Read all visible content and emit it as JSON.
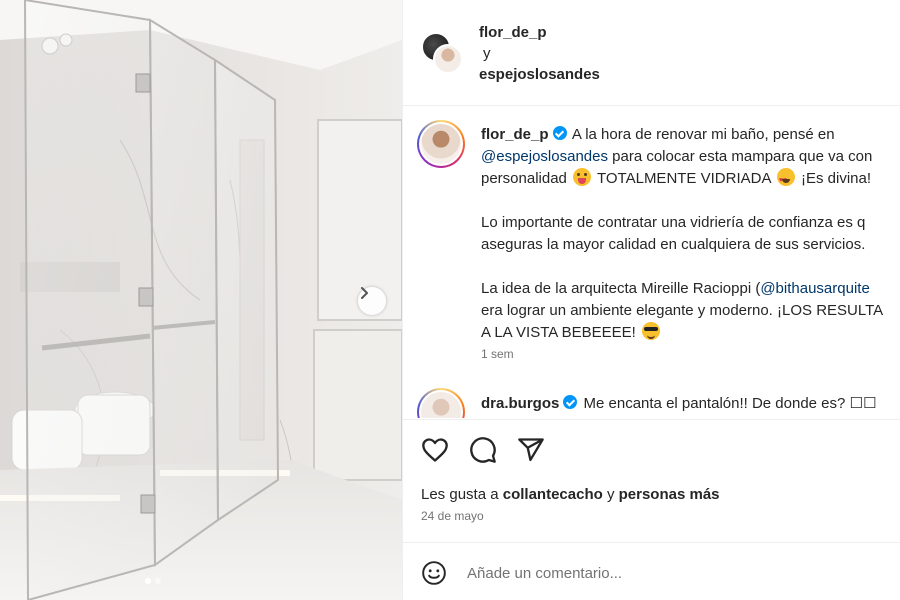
{
  "post_header": {
    "collaborator_1": "flor_de_p",
    "joiner": "y",
    "collaborator_2": "espejoslosandes"
  },
  "caption": {
    "username": "flor_de_p",
    "line1_text": "A la hora de renovar mi baño, pensé en",
    "line2_mention": "@espejoslosandes",
    "line2_text": " para colocar esta mampara que va con",
    "line3_a": "personalidad",
    "line3_b": "TOTALMENTE VIDRIADA",
    "line3_c": "¡Es divina!",
    "line4": "Lo importante de contratar una vidriería de confianza es q",
    "line5": "aseguras la mayor calidad en cualquiera de sus servicios.",
    "line6_a": "La idea de la arquitecta Mireille Racioppi (",
    "line6_mention": "@bithausarquite",
    "line7": "era lograr un ambiente elegante y moderno. ¡LOS RESULTA",
    "line8": "A LA VISTA BEBEEEE!",
    "time_ago": "1 sem"
  },
  "comment": {
    "username": "dra.burgos",
    "text": "Me encanta el pantalón!! De donde es? ☐☐"
  },
  "likes": {
    "prefix": "Les gusta a ",
    "user": "collantecacho",
    "middle": " y ",
    "others": "personas más"
  },
  "date": "24 de mayo",
  "comment_input": {
    "placeholder": "Añade un comentario..."
  },
  "icons": {
    "like": "heart-icon",
    "comment": "comment-icon",
    "share": "share-icon",
    "emoji": "smiley-icon",
    "next": "chevron-right-icon"
  },
  "carousel": {
    "total_dots": 2,
    "active_index": 0
  },
  "colors": {
    "mention": "#00376b",
    "verified": "#0095f6",
    "muted": "#737373",
    "text": "#262626"
  }
}
